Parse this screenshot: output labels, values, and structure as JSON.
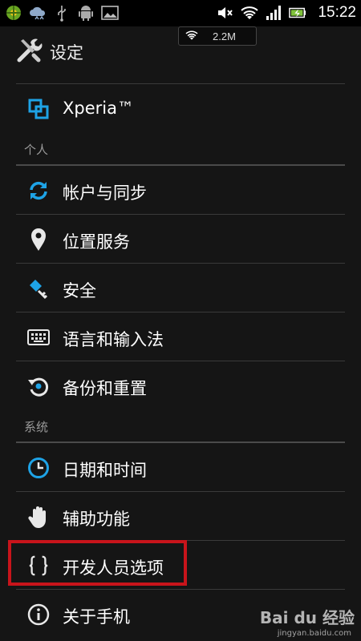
{
  "status_bar": {
    "time": "15:22",
    "icons_left": [
      "app-notification-icon",
      "cloud-upload-icon",
      "usb-icon",
      "android-icon",
      "gallery-icon"
    ],
    "icons_right": [
      "mute-icon",
      "wifi-icon",
      "signal-icon",
      "battery-icon"
    ]
  },
  "network_indicator": {
    "speed": "2.2M"
  },
  "action_bar": {
    "title": "设定",
    "icon": "settings-tools-icon"
  },
  "watermark": {
    "text": "Bai du 经验",
    "sub": "jingyan.baidu.com"
  },
  "colors": {
    "accent": "#1ea3e6",
    "highlight": "#c8141b",
    "background": "#151515"
  },
  "menu": {
    "top": [
      {
        "label": "Xperia™",
        "icon": "xperia-icon"
      }
    ],
    "sections": [
      {
        "title": "个人",
        "items": [
          {
            "label": "帐户与同步",
            "icon": "sync-icon"
          },
          {
            "label": "位置服务",
            "icon": "location-icon"
          },
          {
            "label": "安全",
            "icon": "security-key-icon"
          },
          {
            "label": "语言和输入法",
            "icon": "keyboard-icon"
          },
          {
            "label": "备份和重置",
            "icon": "backup-restore-icon"
          }
        ]
      },
      {
        "title": "系统",
        "items": [
          {
            "label": "日期和时间",
            "icon": "clock-icon"
          },
          {
            "label": "辅助功能",
            "icon": "hand-icon"
          },
          {
            "label": "开发人员选项",
            "icon": "braces-icon"
          },
          {
            "label": "关于手机",
            "icon": "info-icon"
          }
        ]
      }
    ]
  }
}
